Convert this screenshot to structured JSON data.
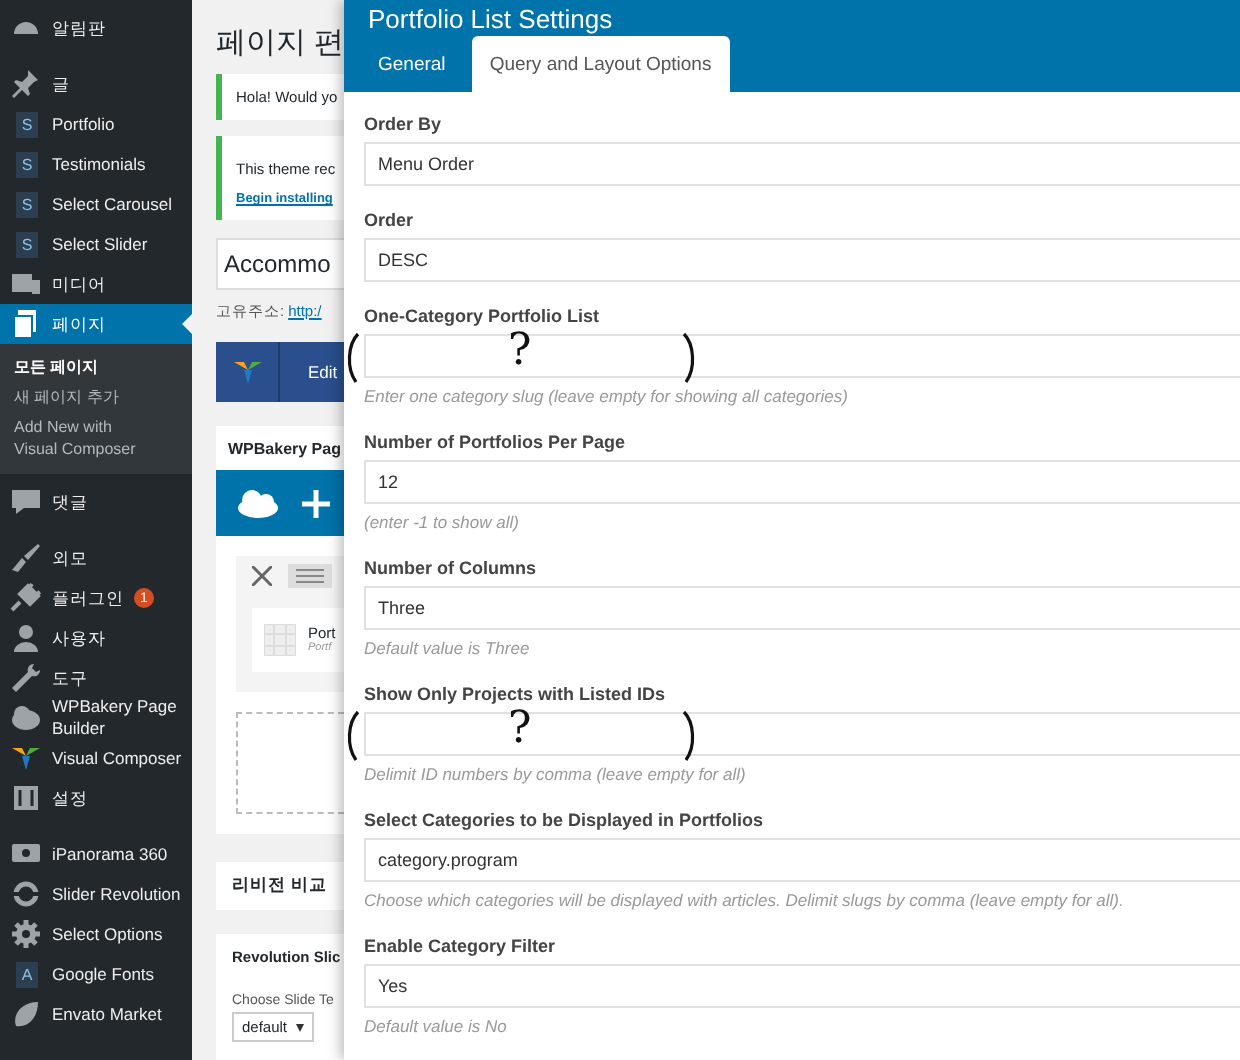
{
  "sidebar": {
    "groups": [
      [
        {
          "label": "알림판",
          "selected": false
        }
      ],
      [
        {
          "label": "글",
          "selected": false
        },
        {
          "label": "Portfolio",
          "selected": false,
          "icon_text": "S"
        },
        {
          "label": "Testimonials",
          "selected": false,
          "icon_text": "S"
        },
        {
          "label": "Select Carousel",
          "selected": false,
          "icon_text": "S"
        },
        {
          "label": "Select Slider",
          "selected": false,
          "icon_text": "S"
        },
        {
          "label": "미디어",
          "selected": false
        },
        {
          "label": "페이지",
          "selected": true,
          "children": [
            {
              "label": "모든 페이지",
              "selected": true
            },
            {
              "label": "새 페이지 추가",
              "selected": false
            },
            {
              "label": "Add New with Visual Composer",
              "selected": false
            }
          ]
        },
        {
          "label": "댓글",
          "selected": false
        }
      ],
      [
        {
          "label": "외모",
          "selected": false
        },
        {
          "label": "플러그인",
          "selected": false,
          "badge": "1"
        },
        {
          "label": "사용자",
          "selected": false
        },
        {
          "label": "도구",
          "selected": false
        },
        {
          "label": "WPBakery Page Builder",
          "selected": false
        },
        {
          "label": "Visual Composer",
          "selected": false
        },
        {
          "label": "설정",
          "selected": false
        }
      ],
      [
        {
          "label": "iPanorama 360",
          "selected": false
        },
        {
          "label": "Slider Revolution",
          "selected": false
        },
        {
          "label": "Select Options",
          "selected": false
        },
        {
          "label": "Google Fonts",
          "selected": false,
          "icon_text": "A"
        },
        {
          "label": "Envato Market",
          "selected": false
        }
      ]
    ]
  },
  "content": {
    "title": "페이지 편",
    "notices": [
      {
        "text": "Hola! Would yo"
      },
      {
        "text": "This theme rec",
        "link": "Begin installing"
      }
    ],
    "title_field": {
      "value": "Accommo"
    },
    "permalink": {
      "label": "고유주소:",
      "link": "http:/"
    },
    "edit_button": "Edit",
    "builder": {
      "title": "WPBakery Pag",
      "element": {
        "name": "Port",
        "subtitle": "Portf"
      }
    },
    "revisions": "리비전 비교",
    "revolution": {
      "title": "Revolution Slic",
      "label": "Choose Slide Te",
      "select": "default"
    }
  },
  "modal": {
    "title": "Portfolio List Settings",
    "tabs": [
      {
        "label": "General",
        "selected": false
      },
      {
        "label": "Query and Layout Options",
        "selected": true
      }
    ],
    "fields": [
      {
        "label": "Order By",
        "value": "Menu Order"
      },
      {
        "label": "Order",
        "value": "DESC"
      },
      {
        "label": "One-Category Portfolio List",
        "hint": "Enter one category slug (leave empty for showing all categories)",
        "annotation": "?"
      },
      {
        "label": "Number of Portfolios Per Page",
        "value": "12",
        "hint": "(enter -1 to show all)"
      },
      {
        "label": "Number of Columns",
        "value": "Three",
        "hint": "Default value is Three"
      },
      {
        "label": "Show Only Projects with Listed IDs",
        "hint": "Delimit ID numbers by comma (leave empty for all)",
        "annotation": "?"
      },
      {
        "label": "Select Categories to be Displayed in Portfolios",
        "value": "category.program",
        "hint": "Choose which categories will be displayed with articles. Delimit slugs by comma (leave empty for all)."
      },
      {
        "label": "Enable Category Filter",
        "value": "Yes",
        "hint": "Default value is No"
      }
    ]
  }
}
